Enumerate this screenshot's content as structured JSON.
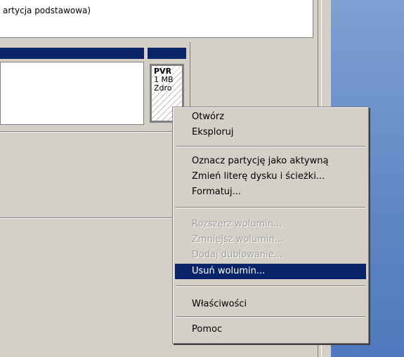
{
  "top_pane": {
    "text": "artycja podstawowa)"
  },
  "volume": {
    "label": "PVR",
    "size": "1 MB",
    "status": "Zdro"
  },
  "context_menu": {
    "items": [
      {
        "label": "Otwórz",
        "enabled": true
      },
      {
        "label": "Eksploruj",
        "enabled": true
      },
      {
        "label": "Oznacz partycję jako aktywną",
        "enabled": true
      },
      {
        "label": "Zmień literę dysku i ścieżki...",
        "enabled": true
      },
      {
        "label": "Formatuj...",
        "enabled": true
      },
      {
        "label": "Rozszerz wolumin...",
        "enabled": false
      },
      {
        "label": "Zmniejsz wolumin...",
        "enabled": false
      },
      {
        "label": "Dodaj dublowanie...",
        "enabled": false
      },
      {
        "label": "Usuń wolumin...",
        "enabled": true,
        "highlighted": true
      },
      {
        "label": "Właściwości",
        "enabled": true
      },
      {
        "label": "Pomoc",
        "enabled": true
      }
    ]
  },
  "colors": {
    "selection": "#0a246a",
    "face": "#d4d0c8",
    "disabled": "#a0a0a0"
  }
}
